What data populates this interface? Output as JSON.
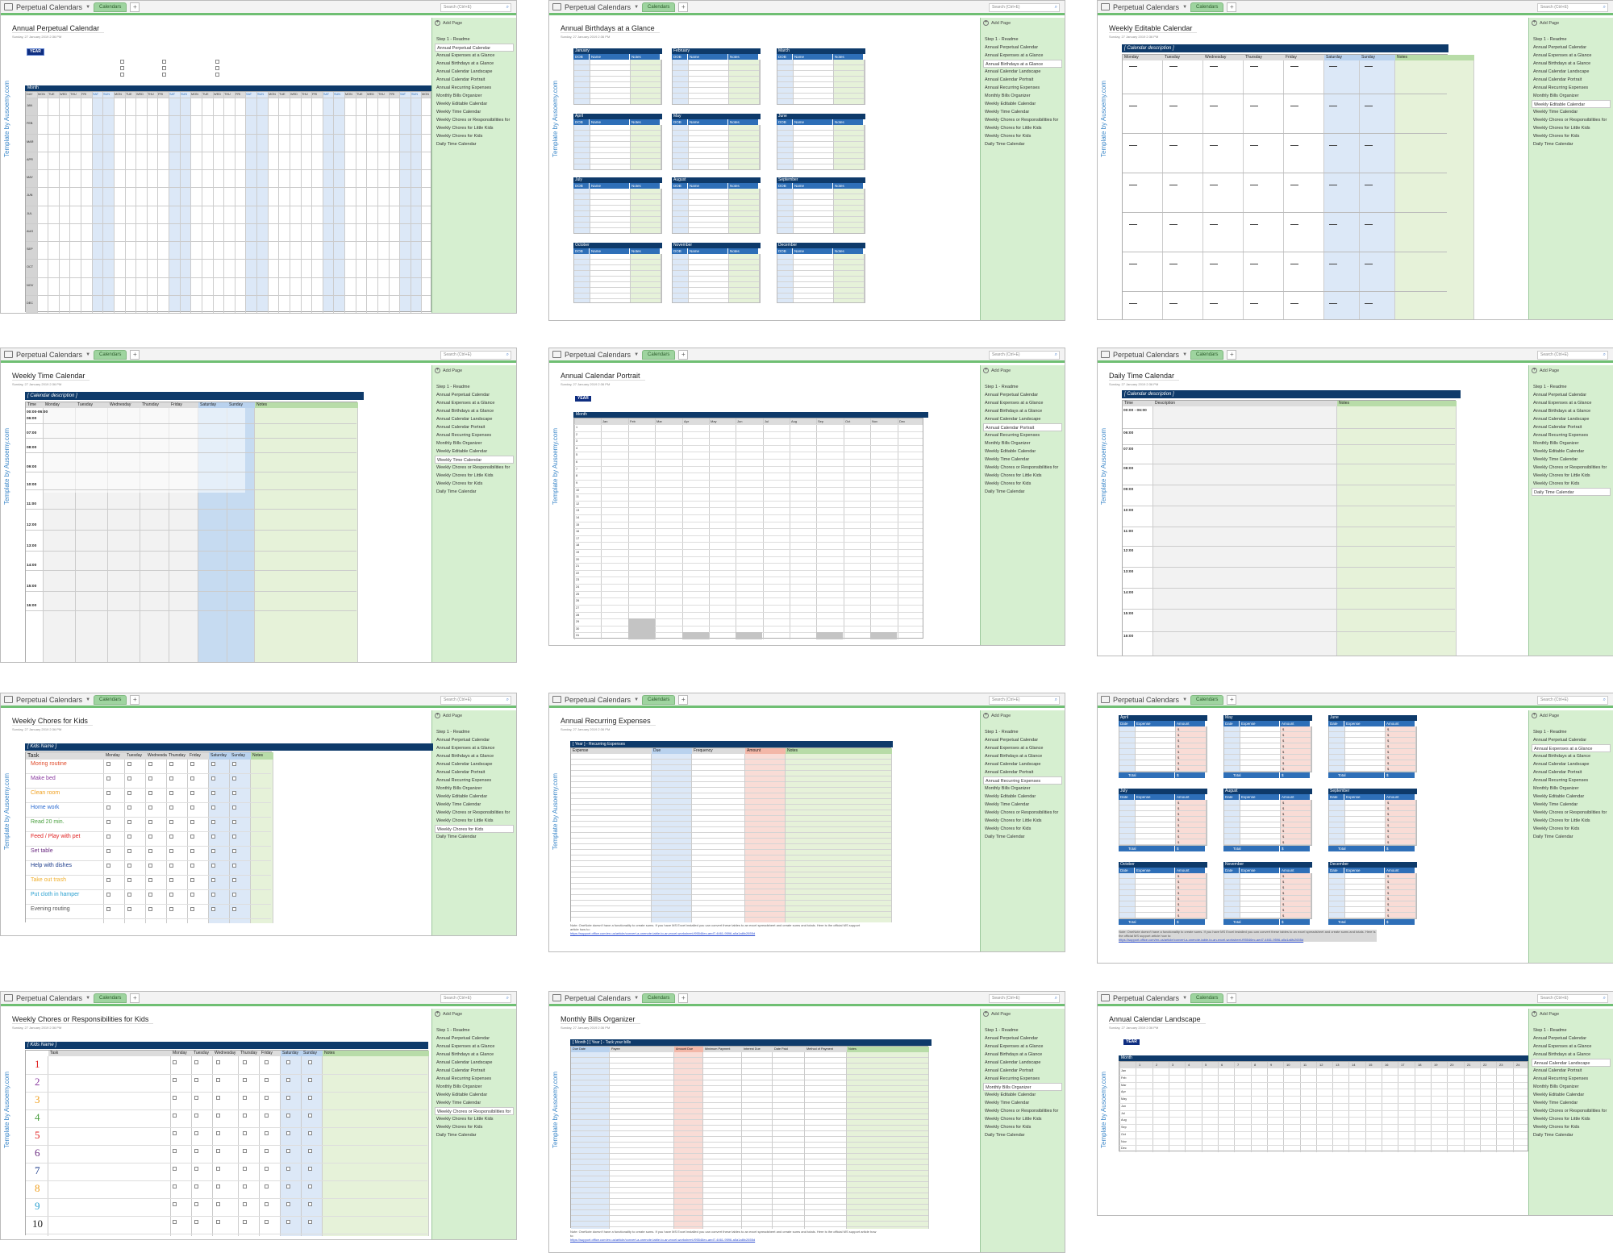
{
  "app": {
    "notebook_title": "Perpetual Calendars",
    "section_tab": "Calendars",
    "search_placeholder": "Search (Ctrl+E)",
    "add_page_label": "Add Page",
    "template_label": "Template by Ausoemy.com",
    "date_line": "Sunday, 27 January 2019     2:36 PM"
  },
  "pages_list": [
    "Step 1 - Readme",
    "Annual Perpetual Calendar",
    "Annual Expenses at a Glance",
    "Annual Birthdays at a Glance",
    "Annual Calendar Landscape",
    "Annual Calendar Portrait",
    "Annual Recurring Expenses",
    "Monthly Bills Organizer",
    "Weekly Editable Calendar",
    "Weekly Time Calendar",
    "Weekly Chores or Responsibilities for",
    "Weekly Chores for Little Kids",
    "Weekly Chores for Kids",
    "Daily Time Calendar"
  ],
  "views": [
    {
      "title": "Annual Perpetual Calendar",
      "selected": 1
    },
    {
      "title": "Annual Birthdays at a Glance",
      "selected": 3
    },
    {
      "title": "Weekly Editable Calendar",
      "selected": 8
    },
    {
      "title": "Weekly Time Calendar",
      "selected": 9
    },
    {
      "title": "Annual Calendar Portrait",
      "selected": 5
    },
    {
      "title": "Daily Time Calendar",
      "selected": 13
    },
    {
      "title": "Weekly Chores for Kids",
      "selected": 12
    },
    {
      "title": "Annual Recurring Expenses",
      "selected": 6
    },
    {
      "title": "",
      "selected": 2
    },
    {
      "title": "Weekly Chores or Responsibilities for Kids",
      "selected": 10
    },
    {
      "title": "Monthly Bills Organizer",
      "selected": 7
    },
    {
      "title": "Annual Calendar Landscape",
      "selected": 4
    }
  ],
  "labels": {
    "year": "YEAR",
    "month": "Month",
    "day": "DAY",
    "calendar_description": "[ Calendar description ]",
    "kids_name": "[ Kids Name ]",
    "recurring_header": "[ Year ] - Recurring Expenses",
    "bills_header": "[ Month ] [ Year ] - Tack your bills",
    "task": "Task",
    "notes": "Notes",
    "time": "Time",
    "description": "Description",
    "total": "Total",
    "dollar": "$"
  },
  "month_abbr_caps": [
    "JAN",
    "FEB",
    "MAR",
    "APR",
    "MAY",
    "JUN",
    "JUL",
    "AUG",
    "SEP",
    "OCT",
    "NOV",
    "DEC"
  ],
  "month_abbr": [
    "Jan",
    "Feb",
    "Mar",
    "Apr",
    "May",
    "Jun",
    "Jul",
    "Aug",
    "Sep",
    "Oct",
    "Nov",
    "Dec"
  ],
  "months_full": [
    "January",
    "February",
    "March",
    "April",
    "May",
    "June",
    "July",
    "August",
    "September",
    "October",
    "November",
    "December"
  ],
  "weekday_caps": [
    "MON",
    "TUE",
    "WED",
    "THU",
    "FRI",
    "SAT",
    "SUN"
  ],
  "weekdays": [
    "Monday",
    "Tuesday",
    "Wednesday",
    "Thursday",
    "Friday",
    "Saturday",
    "Sunday"
  ],
  "birthday_cols": [
    "DOB",
    "Name",
    "Notes"
  ],
  "expense_cols": [
    "Date",
    "Expense",
    "Amount"
  ],
  "recurring_cols": [
    "Expense",
    "Due",
    "Frequency",
    "Amount",
    "Notes"
  ],
  "bills_cols": [
    "Due Date",
    "Payee",
    "Amount Due",
    "Minimum Payment",
    "Interest Due",
    "Date Paid",
    "Method of Payment",
    "Notes"
  ],
  "weekly_times": [
    "00:00-06:00",
    "06:00",
    "07:00",
    "08:00",
    "09:00",
    "10:00",
    "11:00",
    "12:00",
    "13:00",
    "14:00",
    "15:00",
    "16:00"
  ],
  "daily_times": [
    "00:00 - 06:00",
    "06:00",
    "07:00",
    "08:00",
    "09:00",
    "10:00",
    "11:00",
    "12:00",
    "13:00",
    "14:00",
    "15:00",
    "16:00"
  ],
  "chores": [
    {
      "text": "Moring routine",
      "color": "#e04a2a"
    },
    {
      "text": "Make bed",
      "color": "#8a3aa0"
    },
    {
      "text": "Clean room",
      "color": "#f0a020"
    },
    {
      "text": "Home work",
      "color": "#2a6ad0"
    },
    {
      "text": "Read 20 min.",
      "color": "#4aa040"
    },
    {
      "text": "Feed / Play with pet",
      "color": "#e02020"
    },
    {
      "text": "Set table",
      "color": "#6a2a80"
    },
    {
      "text": "Help with dishes",
      "color": "#1a3a8a"
    },
    {
      "text": "Take out trash",
      "color": "#f0b030"
    },
    {
      "text": "Put cloth in hamper",
      "color": "#2aa0d0"
    },
    {
      "text": "Evening routing",
      "color": "#555555"
    }
  ],
  "numbered_rows": [
    {
      "n": "1",
      "color": "#e02020"
    },
    {
      "n": "2",
      "color": "#8a3aa0"
    },
    {
      "n": "3",
      "color": "#f0a020"
    },
    {
      "n": "4",
      "color": "#4aa040"
    },
    {
      "n": "5",
      "color": "#e02020"
    },
    {
      "n": "6",
      "color": "#6a2a80"
    },
    {
      "n": "7",
      "color": "#1a3a8a"
    },
    {
      "n": "8",
      "color": "#f0a020"
    },
    {
      "n": "9",
      "color": "#2aa0d0"
    },
    {
      "n": "10",
      "color": "#222222"
    }
  ],
  "note_text": "Note: OneNote doesn't have a functionality to create sums. If you have MS Excel installed you can convert these tables to an excel spreadsheet and create sums and totals. Here is the official MS support article how to:",
  "note_link": "https://support.office.com/en-us/article/convert-a-onenote-table-to-an-excel-worksheet-f95546ec-aed7-4461-9596-a0a1a6fc2655d",
  "colors": {
    "accent_green": "#6fbf73",
    "navy": "#0e3a6a",
    "col_blue": "#2e6fb8",
    "weekend": "#dce8f7",
    "notes_green": "#e6f2d9",
    "amount_pink": "#f9dcd6"
  }
}
